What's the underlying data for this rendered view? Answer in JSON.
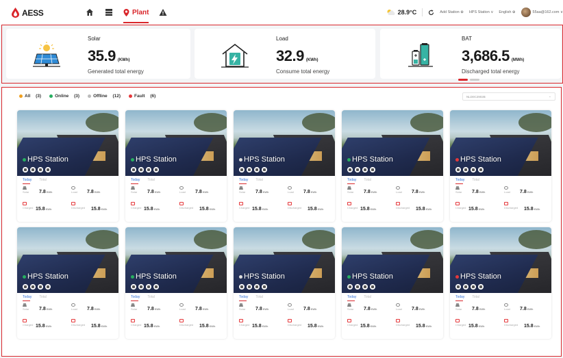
{
  "brand": {
    "name": "AESS"
  },
  "nav": {
    "plant_label": "Plant"
  },
  "header": {
    "temperature": "28.9°C",
    "add_station": "Add Station ⊕",
    "station_select": "HPS Station ∨",
    "language": "English ⊕",
    "user_email": "55aa@162.com ∨"
  },
  "summary": {
    "cards": [
      {
        "title": "Solar",
        "value": "35.9",
        "unit": "(KWh)",
        "subtitle": "Generated total energy"
      },
      {
        "title": "Load",
        "value": "32.9",
        "unit": "(KWh)",
        "subtitle": "Consume total energy"
      },
      {
        "title": "BAT",
        "value": "3,686.5",
        "unit": "(MWh)",
        "subtitle": "Discharged total energy"
      }
    ]
  },
  "filters": {
    "items": [
      {
        "label": "All",
        "count": "(3)",
        "color": "#f0a020"
      },
      {
        "label": "Online",
        "count": "(3)",
        "color": "#27ae60"
      },
      {
        "label": "Offline",
        "count": "(12)",
        "color": "#bbbbbb"
      },
      {
        "label": "Fault",
        "count": "(6)",
        "color": "#e5383b"
      }
    ],
    "search_value": "NLD0C2902B"
  },
  "station_labels": {
    "today": "Today",
    "total": "Total",
    "solar": "Solar",
    "load": "Load",
    "charged": "Charged",
    "discharged": "Discharged",
    "value": "7.8",
    "value2": "15.8",
    "unit": "KWh"
  },
  "stations": [
    {
      "name": "HPS Station",
      "status_color": "#27ae60"
    },
    {
      "name": "HPS Station",
      "status_color": "#27ae60"
    },
    {
      "name": "HPS Station",
      "status_color": "#dddddd"
    },
    {
      "name": "HPS Station",
      "status_color": "#27ae60"
    },
    {
      "name": "HPS Station",
      "status_color": "#e5383b"
    },
    {
      "name": "HPS Station",
      "status_color": "#27ae60"
    },
    {
      "name": "HPS Station",
      "status_color": "#27ae60"
    },
    {
      "name": "HPS Station",
      "status_color": "#dddddd"
    },
    {
      "name": "HPS Station",
      "status_color": "#27ae60"
    },
    {
      "name": "HPS Station",
      "status_color": "#e5383b"
    }
  ],
  "colors": {
    "accent": "#d9262b",
    "link": "#2f6fd6"
  },
  "icons": [
    "logo-drop-icon",
    "home-icon",
    "dashboard-icon",
    "plant-pin-icon",
    "alarm-icon",
    "weather-icon",
    "refresh-icon",
    "solar-panel-icon",
    "house-bolt-icon",
    "battery-icon"
  ]
}
